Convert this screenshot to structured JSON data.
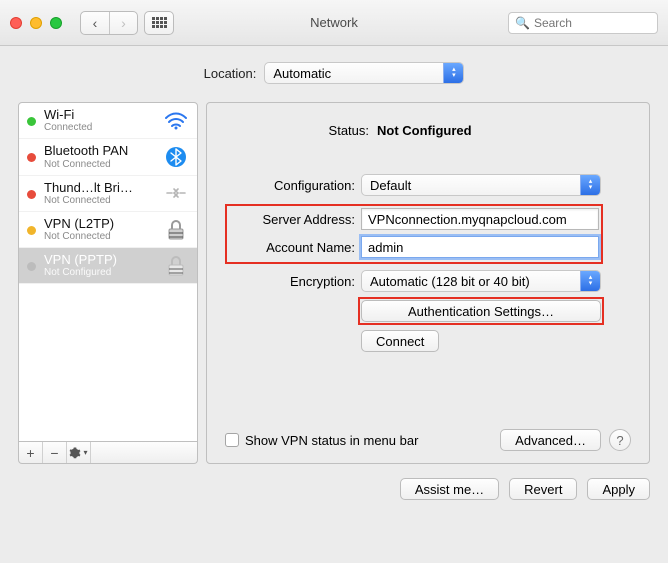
{
  "window": {
    "title": "Network",
    "search_placeholder": "Search"
  },
  "location": {
    "label": "Location:",
    "value": "Automatic"
  },
  "sidebar": {
    "items": [
      {
        "title": "Wi-Fi",
        "subtitle": "Connected",
        "dot": "green"
      },
      {
        "title": "Bluetooth PAN",
        "subtitle": "Not Connected",
        "dot": "red"
      },
      {
        "title": "Thund…lt Bridge",
        "subtitle": "Not Connected",
        "dot": "red"
      },
      {
        "title": "VPN (L2TP)",
        "subtitle": "Not Connected",
        "dot": "orange"
      },
      {
        "title": "VPN (PPTP)",
        "subtitle": "Not Configured",
        "dot": "grey"
      }
    ]
  },
  "detail": {
    "status_label": "Status:",
    "status_value": "Not Configured",
    "config_label": "Configuration:",
    "config_value": "Default",
    "server_label": "Server Address:",
    "server_value": "VPNconnection.myqnapcloud.com",
    "account_label": "Account Name:",
    "account_value": "admin",
    "encryption_label": "Encryption:",
    "encryption_value": "Automatic (128 bit or 40 bit)",
    "auth_button": "Authentication Settings…",
    "connect_button": "Connect",
    "show_status_label": "Show VPN status in menu bar",
    "advanced_button": "Advanced…"
  },
  "footer": {
    "assist": "Assist me…",
    "revert": "Revert",
    "apply": "Apply"
  }
}
